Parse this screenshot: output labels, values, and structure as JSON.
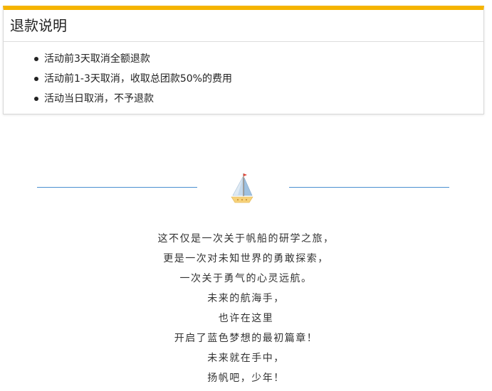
{
  "refund": {
    "title": "退款说明",
    "items": [
      "活动前3天取消全额退款",
      "活动前1-3天取消，收取总团款50%的费用",
      "活动当日取消，不予退款"
    ]
  },
  "decor": {
    "icon": "sailboat-icon",
    "accent_color": "#f5b400",
    "line_color": "#4a8fd0"
  },
  "poem": {
    "lines": [
      "这不仅是一次关于帆船的研学之旅，",
      "更是一次对未知世界的勇敢探索，",
      "一次关于勇气的心灵远航。",
      "未来的航海手，",
      "也许在这里",
      "开启了蓝色梦想的最初篇章！",
      "未来就在手中，",
      "扬帆吧，少年！"
    ]
  }
}
